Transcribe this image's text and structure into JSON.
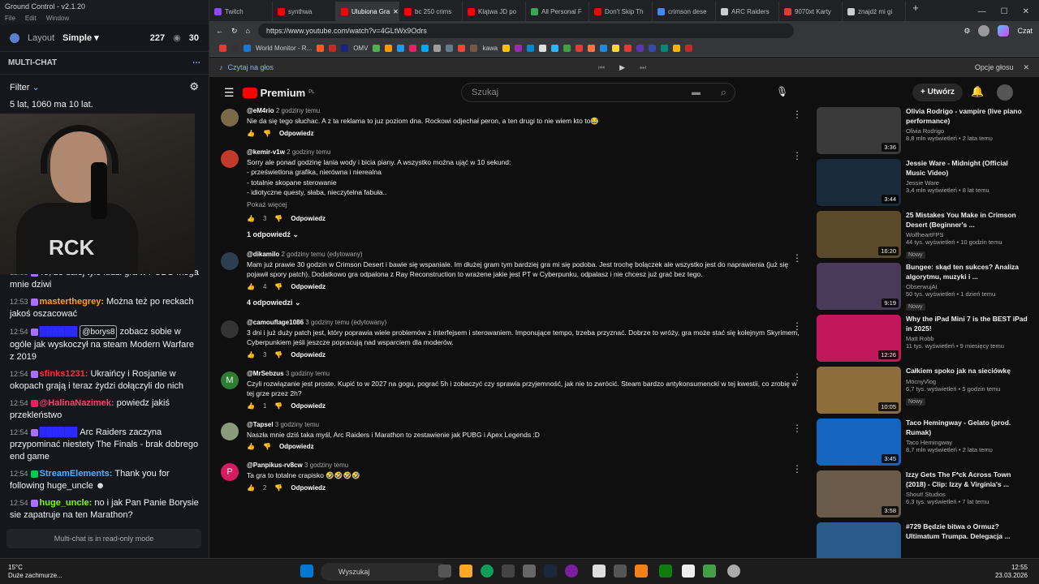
{
  "app": {
    "title": "Ground Control - v2.1.20",
    "menu": [
      "File",
      "Edit",
      "Window"
    ],
    "layout_label": "Layout",
    "layout_value": "Simple",
    "viewer_count": "227",
    "other_count": "30"
  },
  "multichat": {
    "title": "MULTI-CHAT",
    "filter": "Filter",
    "readonly": "Multi-chat is in read-only mode"
  },
  "chat": [
    {
      "time": "",
      "user": "",
      "color": "#fff",
      "text": "5 lat, 1060 ma 10 lat."
    },
    {
      "time": "12:53",
      "user": "",
      "color": "#a970ff",
      "text": "To, że dalej tyle ludzi gra w PUBG mega mnie dziwi"
    },
    {
      "time": "12:53",
      "user": "masterthegrey:",
      "color": "#ff9f1c",
      "text": "Można też po reckach jakoś oszacować"
    },
    {
      "time": "12:54",
      "user": "",
      "color": "#2a2aff",
      "text": "zobacz sobie w ogóle jak wyskoczył na steam Modern Warfare z 2019",
      "mention": "@borys8"
    },
    {
      "time": "12:54",
      "user": "sfinks1231:",
      "color": "#ff3030",
      "text": "Ukraińcy i Rosjanie w okopach grają i teraz żydzi dołączyli do nich"
    },
    {
      "time": "12:54",
      "user": "@HalinaNazimek:",
      "color": "#ff3d6e",
      "text": "powiedz jakiś przekleństwo"
    },
    {
      "time": "12:54",
      "user": "",
      "color": "#2a2aff",
      "text": "Arc Raiders zaczyna przypominać niestety The Finals - brak dobrego end game"
    },
    {
      "time": "12:54",
      "user": "StreamElements:",
      "color": "#4fb0ff",
      "text": "Thank you for following huge_uncle"
    },
    {
      "time": "12:54",
      "user": "huge_uncle:",
      "color": "#7cfc00",
      "text": "no i jak Pan Panie Borysie sie zapatruje na ten Marathon?"
    }
  ],
  "tabs": [
    {
      "label": "Twitch",
      "color": "#9146ff"
    },
    {
      "label": "synthwa",
      "color": "#ff0000"
    },
    {
      "label": "Ulubiona Gra",
      "color": "#ff0000",
      "active": true
    },
    {
      "label": "bc 250 crims",
      "color": "#ff0000"
    },
    {
      "label": "Klątwa JD po",
      "color": "#ff0000"
    },
    {
      "label": "All Personal F",
      "color": "#34a853"
    },
    {
      "label": "Don't Skip Th",
      "color": "#ff0000"
    },
    {
      "label": "crimson dese",
      "color": "#4285f4"
    },
    {
      "label": "ARC Raiders",
      "color": "#ccc"
    },
    {
      "label": "9070xt Karty",
      "color": "#e53935"
    },
    {
      "label": "znajdź mi gi",
      "color": "#ccc"
    }
  ],
  "address": {
    "url": "https://www.youtube.com/watch?v=4GLtWx9Odrs",
    "chat_label": "Czat"
  },
  "bookmarks": [
    "World Monitor - R...",
    "OMV",
    "kawa"
  ],
  "reader": {
    "read_aloud": "Czytaj na głos",
    "voice_options": "Opcje głosu"
  },
  "youtube": {
    "logo": "Premium",
    "region": "PL",
    "search_placeholder": "Szukaj",
    "create": "Utwórz"
  },
  "comments": [
    {
      "user": "@eM4rio",
      "time": "2 godziny temu",
      "text": "Nie da się tego słuchac. A z ta reklama to juz poziom dna.  Rockowi odjechał peron, a ten drugi to nie wiem kto to😂",
      "likes": "",
      "reply": "Odpowiedz",
      "avatar": "#7a6a4a"
    },
    {
      "user": "@kemir-v1w",
      "time": "2 godziny temu",
      "text": "Sorry ale ponad godzinę lania wody i bicia piany.  A wszystko można ująć w 10 sekund:\n- prześwietlona grafika, nierówna i nierealna\n- totalnie skopane sterowanie\n- idiotyczne questy, słaba, nieczytelna fabuła..",
      "more": "Pokaż więcej",
      "likes": "3",
      "reply": "Odpowiedz",
      "replies": "1 odpowiedź",
      "avatar": "#c0392b"
    },
    {
      "user": "@dikamilo",
      "time": "2 godziny temu (edytowany)",
      "text": "Mam już prawie 30 godzin w Crimson Desert i bawie się wspaniale. Im dłużej gram tym bardziej gra mi się podoba. Jest trochę bolączek ale wszystko jest do naprawienia (już się pojawił spory patch). Dodatkowo gra odpalona z Ray Reconstruction to wrażene jakie jest PT w Cyberpunku, odpalasz i nie chcesz już grać bez tego.",
      "likes": "4",
      "reply": "Odpowiedz",
      "replies": "4 odpowiedzi",
      "avatar": "#2c3e50"
    },
    {
      "user": "@camouflage1086",
      "time": "3 godziny temu (edytowany)",
      "text": "3 dni i już duży patch jest, który poprawia wiele problemów z interfejsem i sterowaniem. Imponujące tempo, trzeba przyznać. Dobrze to wróży, gra może stać się kolejnym Skyrimem, Cyberpunkiem jeśli jeszcze popracują nad wsparciem dla moderów.",
      "likes": "3",
      "reply": "Odpowiedz",
      "avatar": "#333"
    },
    {
      "user": "@MrSebzus",
      "time": "3 godziny temu",
      "text": "Czyli rozwiązanie jest proste. Kupić to w 2027 na gogu, pograć 5h i zobaczyć czy sprawia przyjemność, jak nie to zwrócić.  Steam bardzo antykonsumencki w tej kwestii, co zrobię w tej grze przez 2h?",
      "likes": "1",
      "reply": "Odpowiedz",
      "avatar": "#2e7d32",
      "initial": "M"
    },
    {
      "user": "@Tapsel",
      "time": "3 godziny temu",
      "text": "Naszła mnie dziś taka myśl, Arc Raiders i Marathon to zestawienie jak PUBG i Apex Legends :D",
      "likes": "",
      "reply": "Odpowiedz",
      "avatar": "#8a9a7a"
    },
    {
      "user": "@Panpikus-rv8cw",
      "time": "3 godziny temu",
      "text": "Ta gra to totalne crapisko 🤣🤣🤣🤣",
      "likes": "2",
      "reply": "Odpowiedz",
      "avatar": "#d81b60",
      "initial": "P"
    }
  ],
  "related": [
    {
      "title": "Olivia Rodrigo - vampire (live piano performance)",
      "channel": "Olivia Rodrigo",
      "meta": "8,8 mln wyświetleń • 2 lata temu",
      "duration": "3:36",
      "color": "#3a3a3a"
    },
    {
      "title": "Jessie Ware - Midnight (Official Music Video)",
      "channel": "Jessie Ware",
      "meta": "3,4 mln wyświetleń • 8 lat temu",
      "duration": "3:44",
      "color": "#1a2a3a"
    },
    {
      "title": "25 Mistakes You Make in Crimson Desert (Beginner's ...",
      "channel": "WolfheartFPS",
      "meta": "44 tys. wyświetleń • 10 godzin temu",
      "duration": "16:20",
      "color": "#5a4a2a",
      "badge": "Nowy"
    },
    {
      "title": "Bungee: skąd ten sukces? Analiza algorytmu, muzyki i ...",
      "channel": "ObserwujAI",
      "meta": "50 tys. wyświetleń • 1 dzień temu",
      "duration": "9:19",
      "color": "#4a3a5a",
      "badge": "Nowy"
    },
    {
      "title": "Why the iPad Mini 7 is the BEST iPad in 2025!",
      "channel": "Matt Robb",
      "meta": "11 tys. wyświetleń • 9 miesięcy temu",
      "duration": "12:26",
      "color": "#c2185b"
    },
    {
      "title": "Całkiem spoko jak na sieciówkę",
      "channel": "MocnyVlog",
      "meta": "6,7 tys. wyświetleń • 5 godzin temu",
      "duration": "10:05",
      "color": "#8d6e3a",
      "badge": "Nowy"
    },
    {
      "title": "Taco Hemingway - Gelato (prod. Rumak)",
      "channel": "Taco Hemingway",
      "meta": "8,7 mln wyświetleń • 2 lata temu",
      "duration": "3:45",
      "color": "#1565c0"
    },
    {
      "title": "Izzy Gets The F*ck Across Town (2018) - Clip: Izzy & Virginia's ...",
      "channel": "Shout! Studios",
      "meta": "6,3 tys. wyświetleń • 7 lat temu",
      "duration": "3:58",
      "color": "#6a5a4a"
    },
    {
      "title": "#729 Będzie bitwa o Ormuz? Ultimatum Trumpa. Delegacja ...",
      "channel": "",
      "meta": "",
      "duration": "",
      "color": "#2a5a8a"
    }
  ],
  "taskbar": {
    "temp": "15°C",
    "weather": "Duże zachmurze...",
    "search": "Wyszukaj",
    "time": "12:55",
    "date": "23.03.2026"
  }
}
